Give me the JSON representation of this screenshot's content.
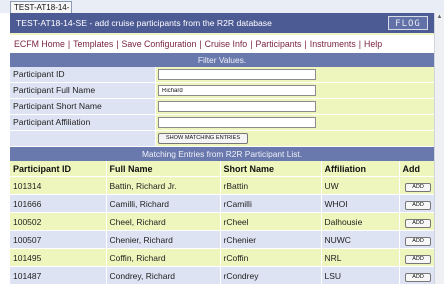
{
  "browser_tab": {
    "label": "TEST-AT18-14-SE"
  },
  "header": {
    "title": "TEST-AT18-14-SE - add cruise participants from the R2R database",
    "logo_text": "FLOG"
  },
  "nav": {
    "links": [
      "ECFM Home",
      "Templates",
      "Save Configuration",
      "Cruise Info",
      "Participants",
      "Instruments",
      "Help"
    ],
    "separator": "|"
  },
  "filter": {
    "header": "Filter Values.",
    "fields": [
      {
        "label": "Participant ID",
        "value": ""
      },
      {
        "label": "Participant Full Name",
        "value": "Richard"
      },
      {
        "label": "Participant Short Name",
        "value": ""
      },
      {
        "label": "Participant Affiliation",
        "value": ""
      }
    ],
    "button_label": "SHOW MATCHING ENTRIES"
  },
  "results": {
    "header": "Matching Entries from R2R Participant List.",
    "columns": [
      "Participant ID",
      "Full Name",
      "Short Name",
      "Affiliation",
      "Add"
    ],
    "add_label": "ADD",
    "rows": [
      {
        "id": "101314",
        "full_name": "Battin, Richard Jr.",
        "short_name": "rBattin",
        "affiliation": "UW"
      },
      {
        "id": "101666",
        "full_name": "Camilli, Richard",
        "short_name": "rCamilli",
        "affiliation": "WHOI"
      },
      {
        "id": "100502",
        "full_name": "Cheel, Richard",
        "short_name": "rCheel",
        "affiliation": "Dalhousie"
      },
      {
        "id": "100507",
        "full_name": "Chenier, Richard",
        "short_name": "rChenier",
        "affiliation": "NUWC"
      },
      {
        "id": "101495",
        "full_name": "Coffin, Richard",
        "short_name": "rCoffin",
        "affiliation": "NRL"
      },
      {
        "id": "101487",
        "full_name": "Condrey, Richard",
        "short_name": "rCondrey",
        "affiliation": "LSU"
      }
    ]
  },
  "colors": {
    "header_blue": "#4d5b95",
    "section_blue": "#6a79ad",
    "row_green": "#eef6bd",
    "row_blue": "#dde3f2",
    "link_color": "#7a2342"
  }
}
